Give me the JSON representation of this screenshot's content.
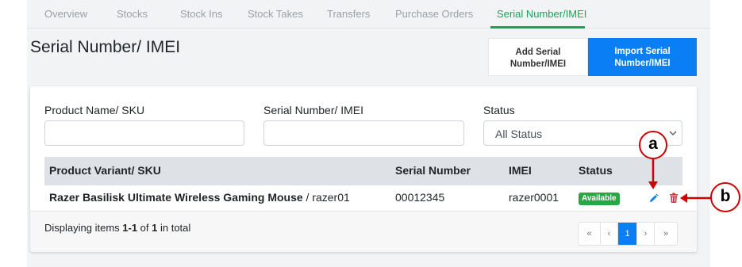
{
  "tabs": [
    {
      "label": "Overview"
    },
    {
      "label": "Stocks"
    },
    {
      "label": "Stock Ins"
    },
    {
      "label": "Stock Takes"
    },
    {
      "label": "Transfers"
    },
    {
      "label": "Purchase Orders"
    },
    {
      "label": "Serial Number/IMEI",
      "active": true
    }
  ],
  "page": {
    "title": "Serial Number/ IMEI"
  },
  "buttons": {
    "add_line1": "Add Serial",
    "add_line2": "Number/IMEI",
    "import_line1": "Import Serial",
    "import_line2": "Number/IMEI"
  },
  "filters": {
    "product_label": "Product Name/ SKU",
    "product_value": "",
    "serial_label": "Serial Number/ IMEI",
    "serial_value": "",
    "status_label": "Status",
    "status_selected": "All Status"
  },
  "table": {
    "headers": [
      "Product Variant/ SKU",
      "Serial Number",
      "IMEI",
      "Status"
    ],
    "rows": [
      {
        "product_name": "Razer Basilisk Ultimate Wireless Gaming Mouse",
        "sku": " / razer01",
        "serial_number": "00012345",
        "imei": "razer0001",
        "status": "Available"
      }
    ]
  },
  "footer": {
    "prefix": "Displaying items ",
    "range": "1-1",
    "mid": " of ",
    "total": "1",
    "suffix": " in total"
  },
  "pagination": {
    "first": "«",
    "prev": "‹",
    "current": "1",
    "next": "›",
    "last": "»"
  },
  "annotations": {
    "a": "a",
    "b": "b"
  },
  "colors": {
    "accent_green": "#1aa35a",
    "primary_blue": "#0a7ff5",
    "badge_green": "#28a745",
    "delete_red": "#dc3545",
    "annotation_red": "#d00000"
  },
  "icons": {
    "edit": "pencil-icon",
    "delete": "trash-icon",
    "select": "chevron-down-icon"
  }
}
